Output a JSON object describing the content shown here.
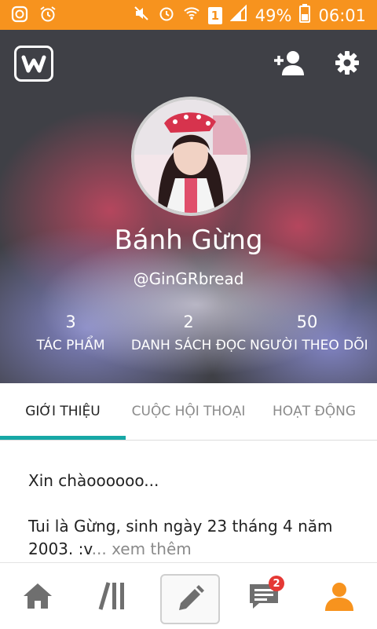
{
  "status_bar": {
    "battery": "49%",
    "time": "06:01",
    "sim": "1"
  },
  "profile": {
    "name": "Bánh Gừng",
    "handle": "@GinGRbread",
    "stats": [
      {
        "value": "3",
        "label": "TÁC PHẨM"
      },
      {
        "value": "2",
        "label": "DANH SÁCH ĐỌC"
      },
      {
        "value": "50",
        "label": "NGƯỜI THEO DÕI"
      }
    ]
  },
  "tabs": [
    {
      "label": "GIỚI THIỆU",
      "active": true
    },
    {
      "label": "CUỘC HỘI THOẠI",
      "active": false
    },
    {
      "label": "HOẠT ĐỘNG",
      "active": false
    }
  ],
  "about": {
    "line1": "Xin chàoooooo...",
    "line2": "Tui là Gừng, sinh ngày 23 tháng 4 năm 2003. :v",
    "more": "... xem thêm"
  },
  "bottom_nav": {
    "messages_badge": "2"
  },
  "colors": {
    "status_bar": "#f7931e",
    "accent": "#f7931e",
    "tab_indicator": "#16a8a6"
  }
}
